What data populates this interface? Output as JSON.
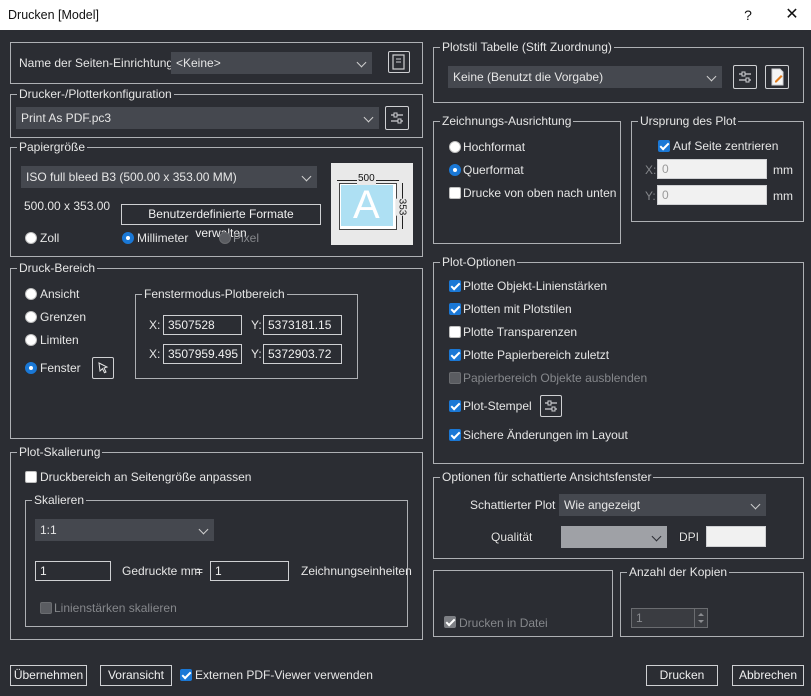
{
  "window": {
    "title": "Drucken [Model]",
    "help": "?",
    "close": "✕"
  },
  "setup": {
    "label": "Name der Seiten-Einrichtung:",
    "value": "<Keine>"
  },
  "printer": {
    "legend": "Drucker-/Plotterkonfiguration",
    "value": "Print As PDF.pc3"
  },
  "paper": {
    "legend": "Papiergröße",
    "value": "ISO full bleed B3 (500.00 x 353.00 MM)",
    "dims": "500.00 x 353.00",
    "custom_button": "Benutzerdefinierte Formate verwalten",
    "units": {
      "inch": "Zoll",
      "mm": "Millimeter",
      "pixel": "Pixel",
      "selected": "mm"
    },
    "preview": {
      "width": "500",
      "height": "353",
      "letter": "A"
    }
  },
  "area": {
    "legend": "Druck-Bereich",
    "options": [
      "Ansicht",
      "Grenzen",
      "Limiten",
      "Fenster"
    ],
    "selected": "Fenster",
    "window_legend": "Fenstermodus-Plotbereich",
    "x1": "3507528",
    "y1": "5373181.15",
    "x2": "3507959.495",
    "y2": "5372903.72",
    "x_label": "X:",
    "y_label": "Y:"
  },
  "scaling": {
    "legend": "Plot-Skalierung",
    "fit": "Druckbereich an Seitengröße anpassen",
    "scale_legend": "Skalieren",
    "scale": "1:1",
    "printed_value": "1",
    "printed_label": "Gedruckte mm",
    "equals": "=",
    "drawing_value": "1",
    "drawing_label": "Zeichnungseinheiten",
    "lineweights": "Linienstärken skalieren"
  },
  "style_table": {
    "legend": "Plotstil Tabelle (Stift Zuordnung)",
    "value": "Keine (Benutzt die Vorgabe)"
  },
  "orientation": {
    "legend": "Zeichnungs-Ausrichtung",
    "portrait": "Hochformat",
    "landscape": "Querformat",
    "selected": "landscape",
    "upside_down": "Drucke von oben nach unten"
  },
  "origin": {
    "legend": "Ursprung des Plot",
    "center": "Auf Seite zentrieren",
    "x": "0",
    "y": "0",
    "unit": "mm",
    "x_label": "X:",
    "y_label": "Y:"
  },
  "plot_options": {
    "legend": "Plot-Optionen",
    "items": [
      {
        "label": "Plotte Objekt-Linienstärken",
        "checked": true,
        "enabled": true
      },
      {
        "label": "Plotten mit Plotstilen",
        "checked": true,
        "enabled": true
      },
      {
        "label": "Plotte Transparenzen",
        "checked": false,
        "enabled": true
      },
      {
        "label": "Plotte Papierbereich zuletzt",
        "checked": true,
        "enabled": true
      },
      {
        "label": "Papierbereich Objekte ausblenden",
        "checked": false,
        "enabled": false
      },
      {
        "label": "Plot-Stempel",
        "checked": true,
        "enabled": true
      },
      {
        "label": "Sichere Änderungen im Layout",
        "checked": true,
        "enabled": true
      }
    ]
  },
  "shaded": {
    "legend": "Optionen für schattierte Ansichtsfenster",
    "plot_label": "Schattierter Plot",
    "plot_value": "Wie angezeigt",
    "quality_label": "Qualität",
    "dpi_label": "DPI"
  },
  "print_to_file": {
    "label": "Drucken in Datei"
  },
  "copies": {
    "legend": "Anzahl der Kopien",
    "value": "1"
  },
  "footer": {
    "apply": "Übernehmen",
    "preview": "Voransicht",
    "external_viewer": "Externen PDF-Viewer verwenden",
    "print": "Drucken",
    "cancel": "Abbrechen"
  },
  "colors": {
    "accent": "#1a78d6",
    "background": "#2b2d33",
    "field": "#45484f"
  }
}
